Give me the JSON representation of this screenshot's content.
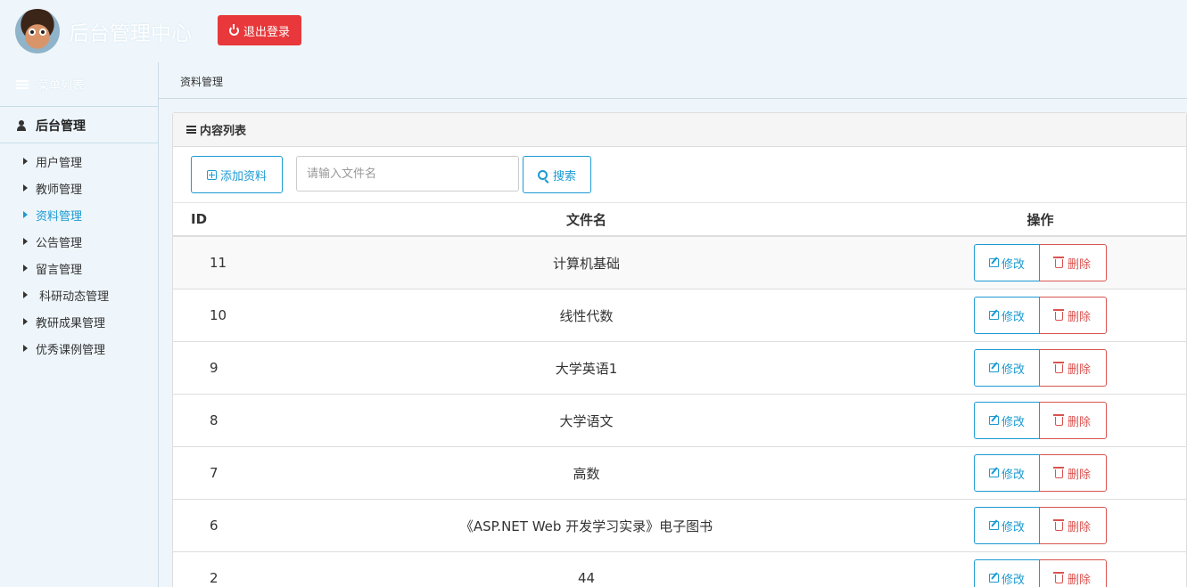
{
  "header": {
    "app_title": "后台管理中心",
    "logout_label": "退出登录",
    "logout_color": "#e8383b"
  },
  "sidebar": {
    "menu_title": "菜单列表",
    "group_title": "后台管理",
    "items": [
      {
        "label": "用户管理",
        "active": false
      },
      {
        "label": "教师管理",
        "active": false
      },
      {
        "label": "资料管理",
        "active": true
      },
      {
        "label": "公告管理",
        "active": false
      },
      {
        "label": "留言管理",
        "active": false
      },
      {
        "label": " 科研动态管理",
        "active": false
      },
      {
        "label": "教研成果管理",
        "active": false
      },
      {
        "label": "优秀课例管理",
        "active": false
      }
    ]
  },
  "breadcrumb": "资料管理",
  "panel": {
    "title": "内容列表",
    "add_label": "添加资料",
    "search_placeholder": "请输入文件名",
    "search_value": "",
    "search_label": "搜索"
  },
  "table": {
    "headers": {
      "id": "ID",
      "name": "文件名",
      "ops": "操作"
    },
    "edit_label": "修改",
    "delete_label": "删除",
    "rows": [
      {
        "id": "11",
        "name": "计算机基础"
      },
      {
        "id": "10",
        "name": "线性代数"
      },
      {
        "id": "9",
        "name": "大学英语1"
      },
      {
        "id": "8",
        "name": "大学语文"
      },
      {
        "id": "7",
        "name": "高数"
      },
      {
        "id": "6",
        "name": "《ASP.NET Web 开发学习实录》电子图书"
      },
      {
        "id": "2",
        "name": "44"
      }
    ]
  },
  "colors": {
    "accent": "#1b9ad1",
    "danger": "#d9534f",
    "background": "#eef6fb"
  }
}
